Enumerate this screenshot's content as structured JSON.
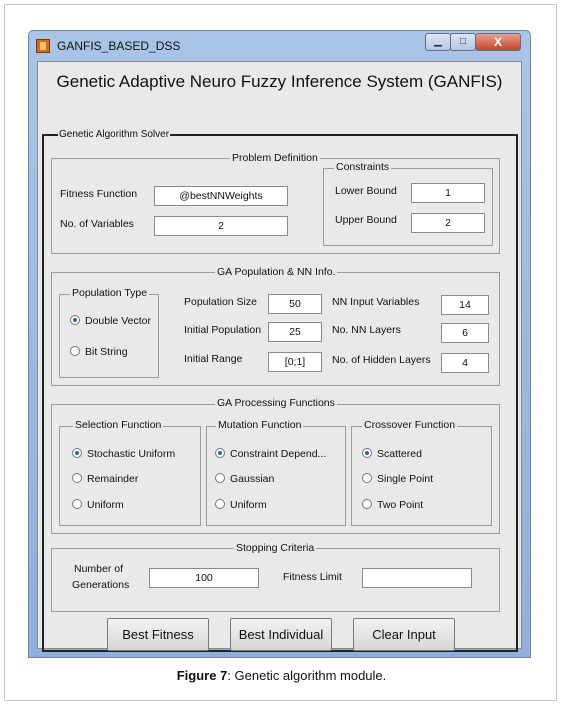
{
  "window": {
    "title": "GANFIS_BASED_DSS",
    "min_glyph": "▁",
    "max_glyph": "□",
    "close_glyph": "X"
  },
  "app_title": "Genetic Adaptive Neuro Fuzzy Inference System (GANFIS)",
  "ga_solver": {
    "legend": "Genetic Algorithm Solver"
  },
  "problem_definition": {
    "legend": "Problem Definition",
    "fitness_function_label": "Fitness Function",
    "fitness_function_value": "@bestNNWeights",
    "num_variables_label": "No. of Variables",
    "num_variables_value": "2",
    "constraints": {
      "legend": "Constraints",
      "lower_bound_label": "Lower Bound",
      "lower_bound_value": "1",
      "upper_bound_label": "Upper Bound",
      "upper_bound_value": "2"
    }
  },
  "population": {
    "legend": "GA Population & NN Info.",
    "population_type": {
      "legend": "Population Type",
      "options": [
        "Double Vector",
        "Bit String"
      ],
      "selected": "Double Vector"
    },
    "population_size_label": "Population Size",
    "population_size_value": "50",
    "initial_population_label": "Initial Population",
    "initial_population_value": "25",
    "initial_range_label": "Initial Range",
    "initial_range_value": "[0;1]",
    "nn_input_variables_label": "NN Input Variables",
    "nn_input_variables_value": "14",
    "nn_layers_label": "No. NN Layers",
    "nn_layers_value": "6",
    "hidden_layers_label": "No. of Hidden Layers",
    "hidden_layers_value": "4"
  },
  "processing": {
    "legend": "GA Processing Functions",
    "selection": {
      "legend": "Selection Function",
      "options": [
        "Stochastic Uniform",
        "Remainder",
        "Uniform"
      ],
      "selected": "Stochastic Uniform"
    },
    "mutation": {
      "legend": "Mutation Function",
      "options": [
        "Constraint Depend...",
        "Gaussian",
        "Uniform"
      ],
      "selected": "Constraint Depend..."
    },
    "crossover": {
      "legend": "Crossover Function",
      "options": [
        "Scattered",
        "Single Point",
        "Two Point"
      ],
      "selected": "Scattered"
    }
  },
  "stopping": {
    "legend": "Stopping Criteria",
    "generations_label_line1": "Number of",
    "generations_label_line2": "Generations",
    "generations_value": "100",
    "fitness_limit_label": "Fitness Limit",
    "fitness_limit_value": ""
  },
  "buttons": {
    "best_fitness": "Best Fitness",
    "best_individual": "Best Individual",
    "clear_input": "Clear Input"
  },
  "caption": {
    "label": "Figure 7",
    "text": ": Genetic algorithm module."
  }
}
